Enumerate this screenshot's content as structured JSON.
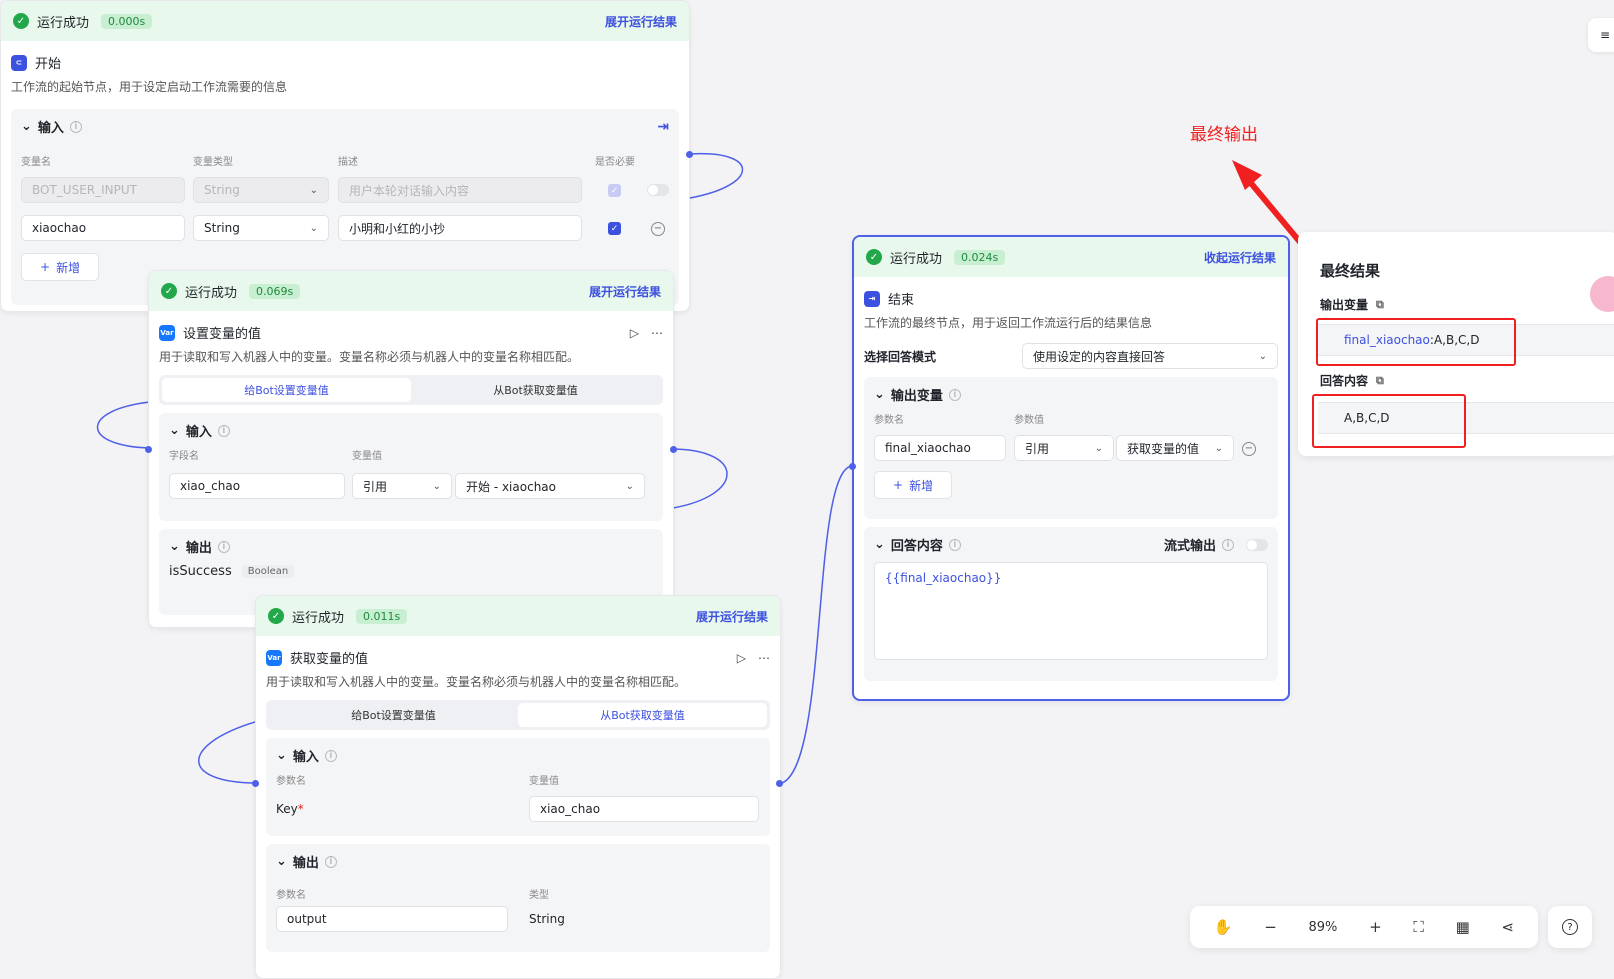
{
  "canvas": {
    "annotation_label": "最终输出",
    "annotation_color": "#f02020",
    "accent_color": "#3d51e0",
    "success_color": "#22a84a"
  },
  "start_node": {
    "run_status": "运行成功",
    "run_time": "0.000s",
    "run_toggle": "展开运行结果",
    "title": "开始",
    "description": "工作流的起始节点，用于设定启动工作流需要的信息",
    "input_title": "输入",
    "columns": [
      "变量名",
      "变量类型",
      "描述",
      "是否必要"
    ],
    "rows": [
      {
        "name": "BOT_USER_INPUT",
        "type": "String",
        "desc_placeholder": "用户本轮对话输入内容"
      },
      {
        "name": "xiaochao",
        "type": "String",
        "desc": "小明和小红的小抄"
      }
    ],
    "add_label": "新增"
  },
  "set_var_node": {
    "run_status": "运行成功",
    "run_time": "0.069s",
    "run_toggle": "展开运行结果",
    "icon_text": "Var",
    "title": "设置变量的值",
    "description": "用于读取和写入机器人中的变量。变量名称必须与机器人中的变量名称相匹配。",
    "tabs": [
      "给Bot设置变量值",
      "从Bot获取变量值"
    ],
    "input_title": "输入",
    "col_field": "字段名",
    "col_value": "变量值",
    "field_name": "xiao_chao",
    "value_mode": "引用",
    "value_ref": "开始 - xiaochao",
    "output_title": "输出",
    "output_name": "isSuccess",
    "output_type": "Boolean"
  },
  "get_var_node": {
    "run_status": "运行成功",
    "run_time": "0.011s",
    "run_toggle": "展开运行结果",
    "icon_text": "Var",
    "title": "获取变量的值",
    "description": "用于读取和写入机器人中的变量。变量名称必须与机器人中的变量名称相匹配。",
    "tabs": [
      "给Bot设置变量值",
      "从Bot获取变量值"
    ],
    "input_title": "输入",
    "col_param": "参数名",
    "col_value": "变量值",
    "key_label": "Key",
    "key_required": "*",
    "key_value": "xiao_chao",
    "output_title": "输出",
    "col_out_param": "参数名",
    "col_out_type": "类型",
    "output_name": "output",
    "output_type": "String"
  },
  "end_node": {
    "run_status": "运行成功",
    "run_time": "0.024s",
    "run_toggle": "收起运行结果",
    "title": "结束",
    "description": "工作流的最终节点，用于返回工作流运行后的结果信息",
    "mode_label": "选择回答模式",
    "mode_value": "使用设定的内容直接回答",
    "output_title": "输出变量",
    "col_param": "参数名",
    "col_value": "参数值",
    "param_name": "final_xiaochao",
    "value_mode": "引用",
    "value_ref": "获取变量的值",
    "add_label": "新增",
    "answer_title": "回答内容",
    "stream_label": "流式输出",
    "answer_template": "{{final_xiaochao}}"
  },
  "result_panel": {
    "title": "最终结果",
    "output_var_label": "输出变量",
    "output_var_key": "final_xiaochao",
    "output_var_sep": " : ",
    "output_var_value": "A,B,C,D",
    "answer_label": "回答内容",
    "answer_value": "A,B,C,D"
  },
  "toolbar": {
    "zoom": "89%"
  }
}
